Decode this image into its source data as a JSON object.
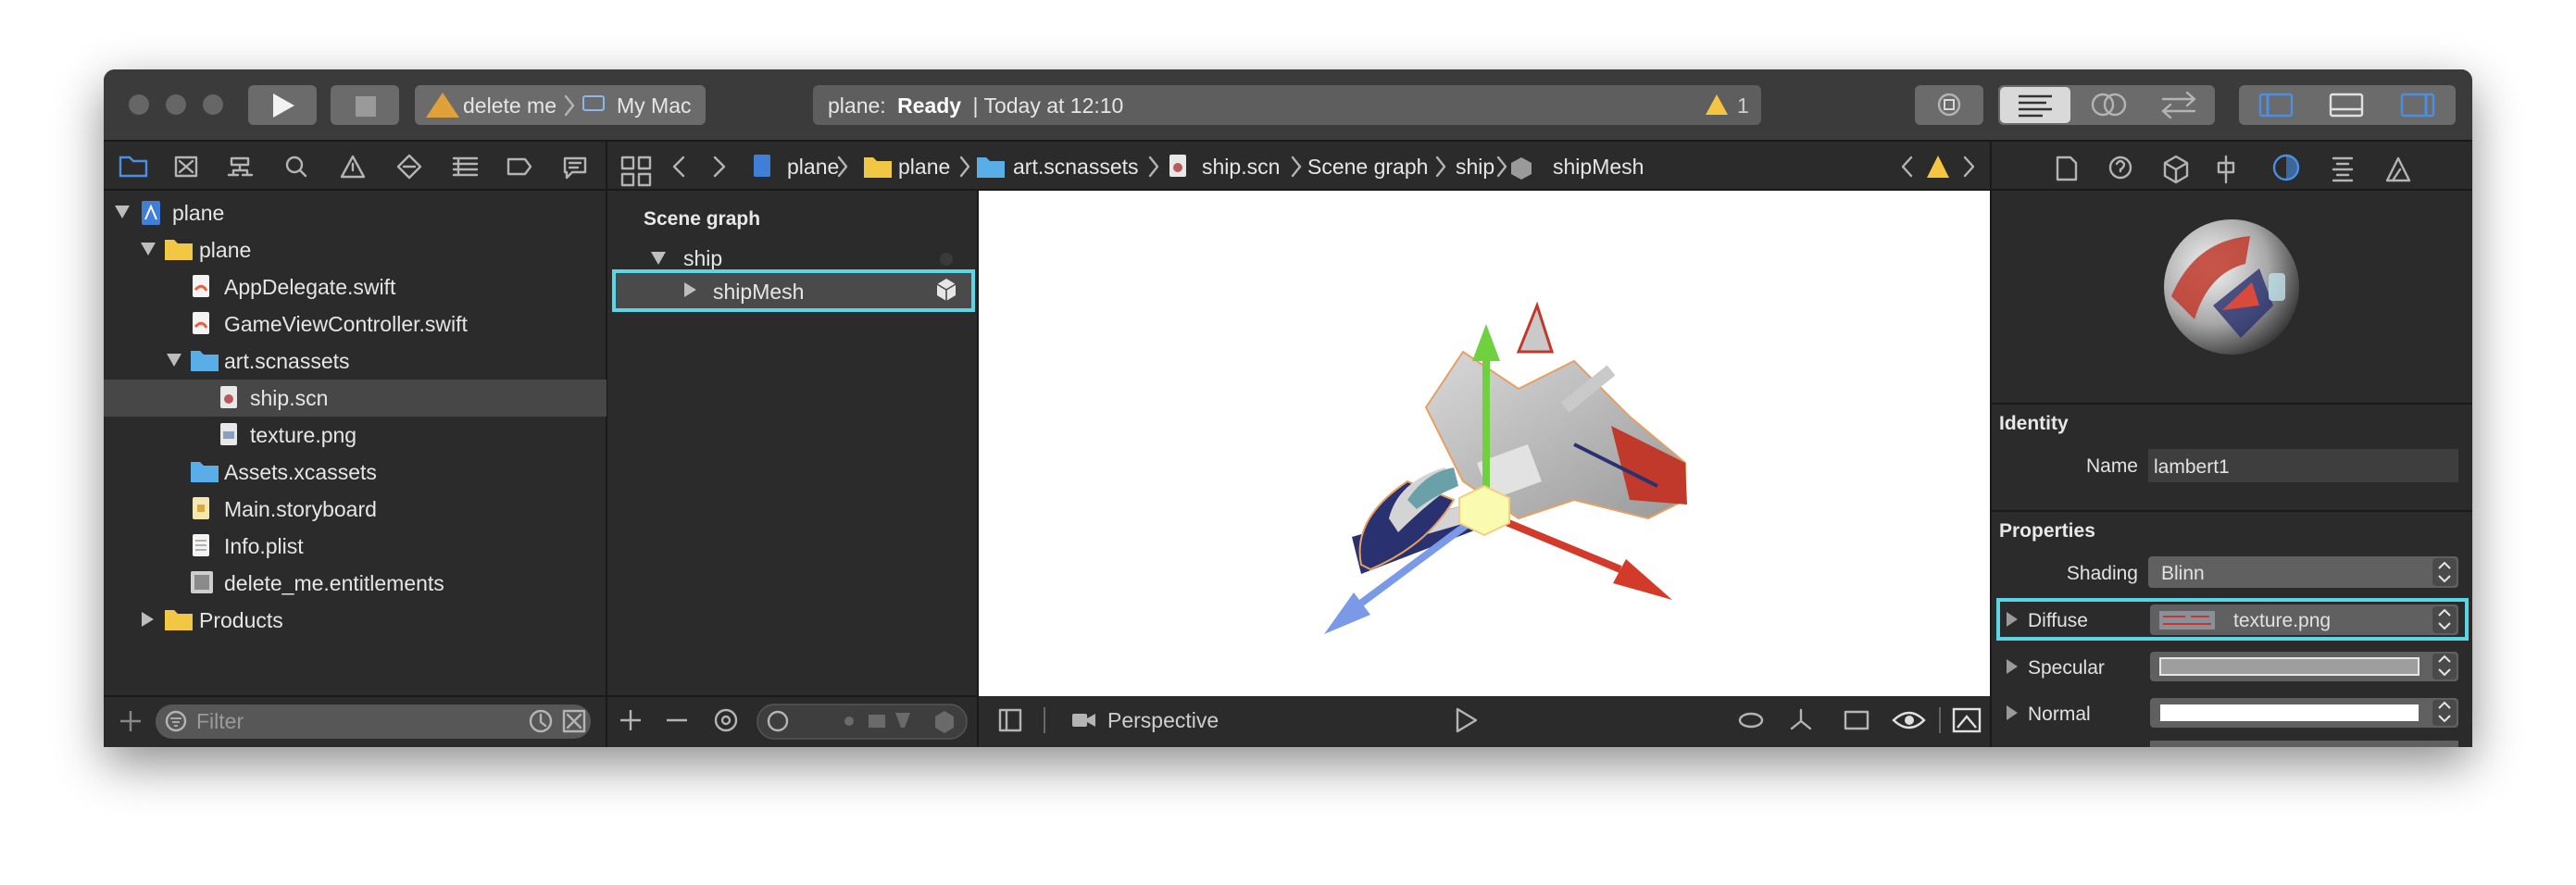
{
  "toolbar": {
    "scheme": "delete me",
    "destination": "My Mac",
    "activity_project": "plane:",
    "activity_status": "Ready",
    "activity_time": "| Today at 12:10",
    "warning_count": "1"
  },
  "jumpbar": {
    "items": [
      "plane",
      "plane",
      "art.scnassets",
      "ship.scn",
      "Scene graph",
      "ship",
      "shipMesh"
    ]
  },
  "navigator": {
    "items": [
      {
        "label": "plane"
      },
      {
        "label": "plane"
      },
      {
        "label": "AppDelegate.swift"
      },
      {
        "label": "GameViewController.swift"
      },
      {
        "label": "art.scnassets"
      },
      {
        "label": "ship.scn"
      },
      {
        "label": "texture.png"
      },
      {
        "label": "Assets.xcassets"
      },
      {
        "label": "Main.storyboard"
      },
      {
        "label": "Info.plist"
      },
      {
        "label": "delete_me.entitlements"
      },
      {
        "label": "Products"
      }
    ],
    "filter_placeholder": "Filter"
  },
  "scene_graph": {
    "title": "Scene graph",
    "nodes": [
      {
        "label": "ship"
      },
      {
        "label": "shipMesh"
      }
    ]
  },
  "viewport": {
    "camera": "Perspective"
  },
  "inspector": {
    "identity_title": "Identity",
    "name_label": "Name",
    "name_value": "lambert1",
    "properties_title": "Properties",
    "shading_label": "Shading",
    "shading_value": "Blinn",
    "diffuse_label": "Diffuse",
    "diffuse_value": "texture.png",
    "specular_label": "Specular",
    "normal_label": "Normal"
  },
  "colors": {
    "accent": "#4a8fe6",
    "highlight": "#5ad6e6",
    "warning": "#f5c542"
  }
}
